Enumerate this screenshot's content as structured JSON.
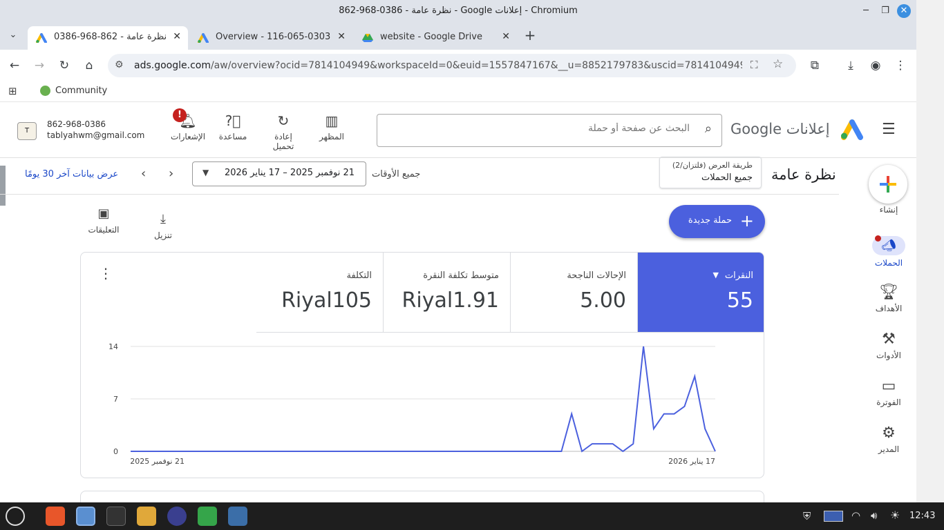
{
  "window": {
    "title": "نظرة عامة - 0386-968-862 - Google إعلانات - Chromium"
  },
  "tabs": [
    {
      "label": "نظرة عامة - 862-968-0386 - e",
      "active": true
    },
    {
      "label": "Overview - 116-065-0303 - G",
      "active": false
    },
    {
      "label": "website - Google Drive",
      "active": false
    }
  ],
  "address": {
    "url_host": "ads.google.com",
    "url_rest": "/aw/overview?ocid=7814104949&workspaceId=0&euid=1557847167&__u=8852179783&uscid=7814104949&__c=952254..."
  },
  "bookmarks": [
    {
      "label": "Community"
    }
  ],
  "ads_header": {
    "product": "إعلانات Google",
    "search_placeholder": "البحث عن صفحة أو حملة",
    "buttons": {
      "appearance": "المظهر",
      "reload_line1": "إعادة",
      "reload_line2": "تحميل",
      "help": "مساعدة",
      "notifications": "الإشعارات"
    },
    "account": {
      "id": "862-968-0386",
      "email": "tablyahwm@gmail.com"
    }
  },
  "rail": {
    "create": "إنشاء",
    "campaigns": "الحملات",
    "goals": "الأهداف",
    "tools": "الأدوات",
    "billing": "الفوترة",
    "admin": "المدير"
  },
  "overview": {
    "title": "نظرة عامة",
    "view_mode_label": "طريقة العرض (فلتزان/2)",
    "view_mode_value": "جميع الحملات",
    "all_times": "جميع الأوقات",
    "date_range": "21 نوفمبر 2025 – 17 يناير 2026",
    "last30": "عرض بيانات آخر 30 يومًا",
    "new_campaign": "حملة جديدة",
    "download": "تنزيل",
    "comments": "التعليقات"
  },
  "metrics": [
    {
      "label": "النقرات",
      "value": "55",
      "selected": true
    },
    {
      "label": "الإحالات الناجحة",
      "value": "5.00",
      "selected": false
    },
    {
      "label": "متوسط تكلفة النقرة",
      "value": "Riyal1.91",
      "selected": false
    },
    {
      "label": "التكلفة",
      "value": "Riyal105",
      "selected": false
    }
  ],
  "chart_data": {
    "type": "line",
    "title": "",
    "x_start_label": "21 نوفمبر 2025",
    "x_end_label": "17 يناير 2026",
    "y_ticks": [
      0,
      7,
      14
    ],
    "ylim": [
      0,
      14
    ],
    "grid": true,
    "series": [
      {
        "values": [
          0,
          0,
          0,
          0,
          0,
          0,
          0,
          0,
          0,
          0,
          0,
          0,
          0,
          0,
          0,
          0,
          0,
          0,
          0,
          0,
          0,
          0,
          0,
          0,
          0,
          0,
          0,
          0,
          0,
          0,
          0,
          0,
          0,
          0,
          0,
          0,
          0,
          0,
          0,
          0,
          0,
          0,
          0,
          5,
          0,
          1,
          1,
          1,
          0,
          1,
          14,
          3,
          5,
          5,
          6,
          10,
          3,
          0
        ]
      }
    ],
    "color": "#4b60de"
  },
  "taskbar": {
    "time": "12:43"
  }
}
